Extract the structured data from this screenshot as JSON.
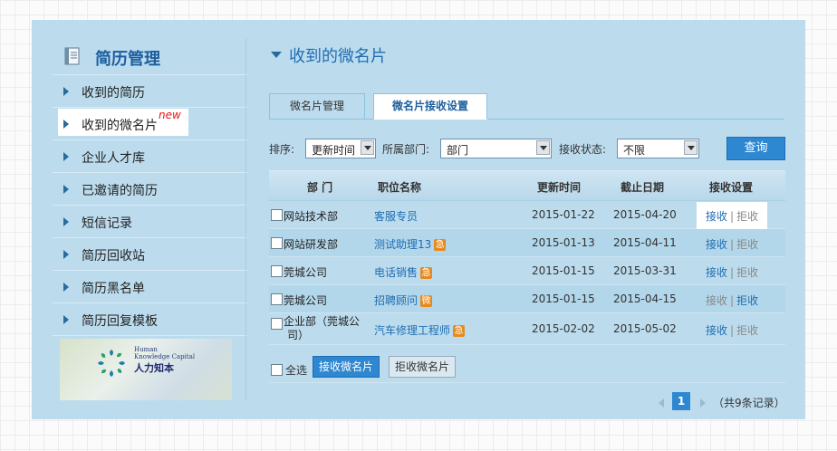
{
  "sidebar": {
    "title": "简历管理",
    "new_tag": "new",
    "items": [
      {
        "label": "收到的简历"
      },
      {
        "label": "收到的微名片"
      },
      {
        "label": "企业人才库"
      },
      {
        "label": "已邀请的简历"
      },
      {
        "label": "短信记录"
      },
      {
        "label": "简历回收站"
      },
      {
        "label": "简历黑名单"
      },
      {
        "label": "简历回复模板"
      }
    ],
    "logo": {
      "en_line1": "Human",
      "en_line2": "Knowledge Capital",
      "cn": "人力知本"
    }
  },
  "main": {
    "title": "收到的微名片",
    "tabs": [
      {
        "label": "微名片管理"
      },
      {
        "label": "微名片接收设置"
      }
    ],
    "filters": {
      "sort_label": "排序:",
      "sort_value": "更新时间",
      "dept_label": "所属部门:",
      "dept_value": "部门",
      "status_label": "接收状态:",
      "status_value": "不限",
      "query": "查询"
    },
    "table": {
      "headers": [
        "部 门",
        "职位名称",
        "更新时间",
        "截止日期",
        "接收设置"
      ],
      "rows": [
        {
          "dept": "网站技术部",
          "job": "客服专员",
          "tag": "",
          "updated": "2015-01-22",
          "deadline": "2015-04-20",
          "accept": "接收",
          "reject": "拒收"
        },
        {
          "dept": "网站研发部",
          "job": "测试助理13",
          "tag": "急",
          "updated": "2015-01-13",
          "deadline": "2015-04-11",
          "accept": "接收",
          "reject": "拒收"
        },
        {
          "dept": "莞城公司",
          "job": "电话销售",
          "tag": "急",
          "updated": "2015-01-15",
          "deadline": "2015-03-31",
          "accept": "接收",
          "reject": "拒收"
        },
        {
          "dept": "莞城公司",
          "job": "招聘顾问",
          "tag": "微",
          "updated": "2015-01-15",
          "deadline": "2015-04-15",
          "accept": "接收",
          "reject": "拒收"
        },
        {
          "dept": "企业部（莞城公司）",
          "dept_l1": "企业部（莞城公",
          "dept_l2": "司）",
          "job": "汽车修理工程师",
          "tag": "急",
          "updated": "2015-02-02",
          "deadline": "2015-05-02",
          "accept": "接收",
          "reject": "拒收"
        }
      ],
      "separator": "|"
    },
    "bulk": {
      "select_all": "全选",
      "accept_btn": "接收微名片",
      "reject_btn": "拒收微名片"
    },
    "pager": {
      "current": "1",
      "total": "（共9条记录）"
    }
  },
  "colors": {
    "panel": "#bcdcee",
    "accent": "#2e87d1",
    "link": "#1f6db1",
    "tag": "#e58a1f",
    "new_tag": "#e81818"
  }
}
